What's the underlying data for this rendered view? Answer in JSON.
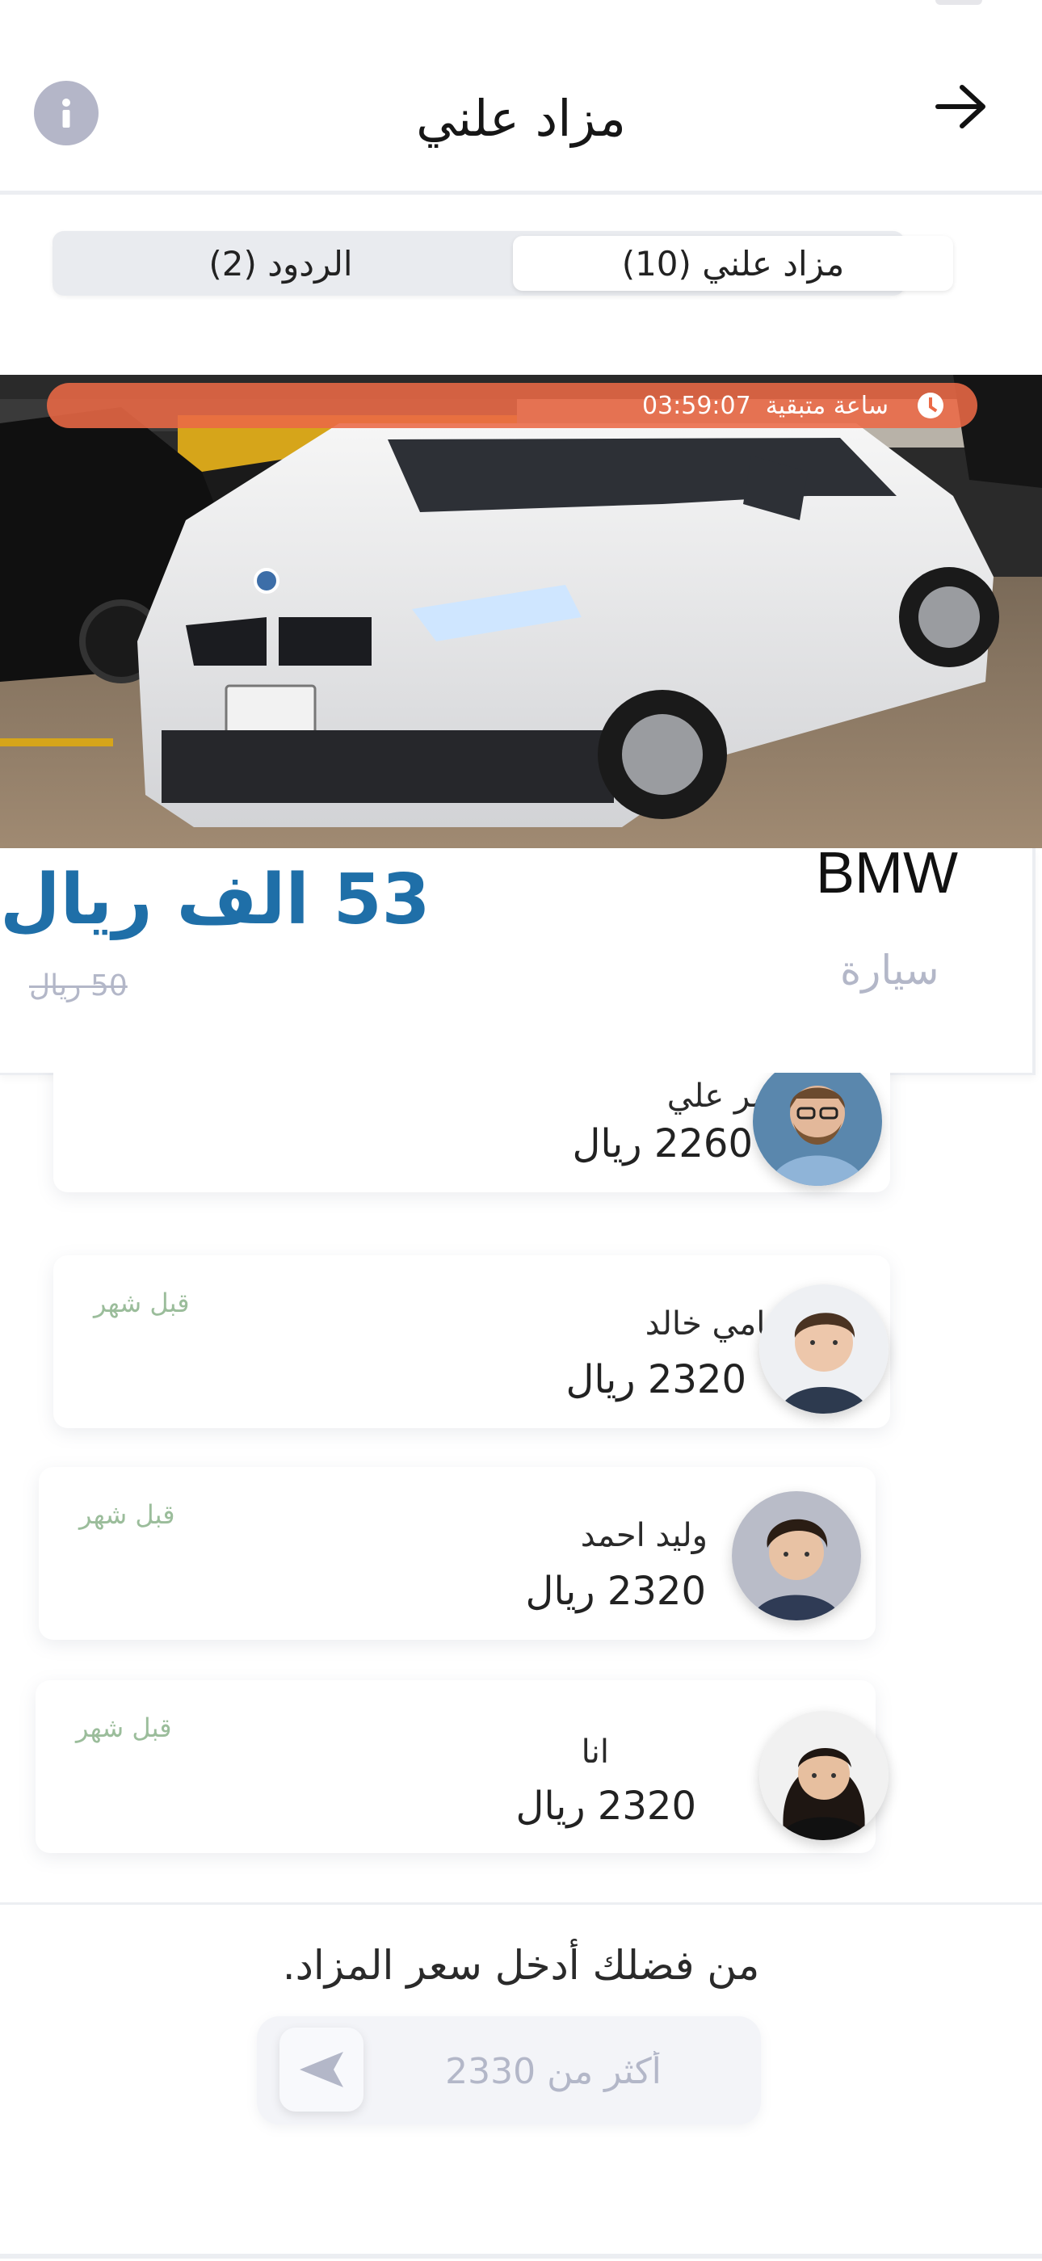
{
  "header": {
    "title": "مزاد علني",
    "back_icon": "arrow-right-icon",
    "info_icon": "info-icon"
  },
  "tabs": [
    {
      "label": "مزاد علني (10)",
      "active": true
    },
    {
      "label": "الردود (2)",
      "active": false
    }
  ],
  "auction": {
    "timer_value": "03:59:07",
    "timer_label": "ساعة متبقية",
    "timer_color": "#eb6946",
    "brand": "BMW",
    "category": "سيارة",
    "current_price": "53 الف ريال",
    "start_price": "50 ريال",
    "price_color": "#1f6fa8"
  },
  "bids": [
    {
      "name": "عمر علي",
      "amount": "2260  ريال",
      "time": ""
    },
    {
      "name": "سامي خالد",
      "amount": "2320  ريال",
      "time": "قبل شهر"
    },
    {
      "name": "وليد احمد",
      "amount": "2320 ريال",
      "time": "قبل شهر"
    },
    {
      "name": "انا",
      "amount": "2320 ريال",
      "time": "قبل شهر"
    }
  ],
  "footer": {
    "prompt": "من فضلك أدخل سعر المزاد.",
    "placeholder": "أكثر من 2330",
    "send_icon": "send-icon"
  }
}
